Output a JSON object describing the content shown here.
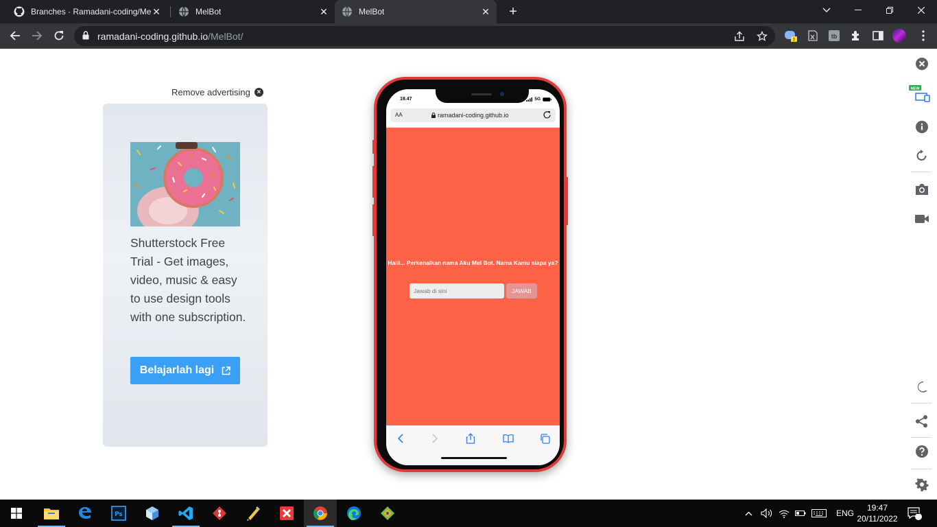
{
  "browser": {
    "tabs": [
      {
        "title": "Branches · Ramadani-coding/Mel",
        "icon": "github-icon"
      },
      {
        "title": "MelBot",
        "icon": "globe-icon"
      },
      {
        "title": "MelBot",
        "icon": "globe-icon",
        "active": true
      }
    ],
    "url_host": "ramadani-coding.github.io",
    "url_path": "/MelBot/"
  },
  "ad": {
    "remove_label": "Remove advertising",
    "text": "Shutterstock Free Trial - Get images, video, music & easy to use design tools with one subscription.",
    "button_label": "Belajarlah lagi"
  },
  "phone": {
    "status_time": "19.47",
    "network": "5G",
    "aa_label": "AA",
    "safari_url": "ramadani-coding.github.io",
    "bot_message": "Haiii... Perkenalkan nama Aku Mel Bot. Nama Kamu siapa ya?",
    "input_placeholder": "Jawab di sini",
    "button_label": "JAWAB",
    "app_color": "#fe6347"
  },
  "sidebar": {
    "new_badge": "NEW"
  },
  "taskbar": {
    "language": "ENG",
    "time": "19:47",
    "date": "20/11/2022",
    "notification_count": "1"
  }
}
